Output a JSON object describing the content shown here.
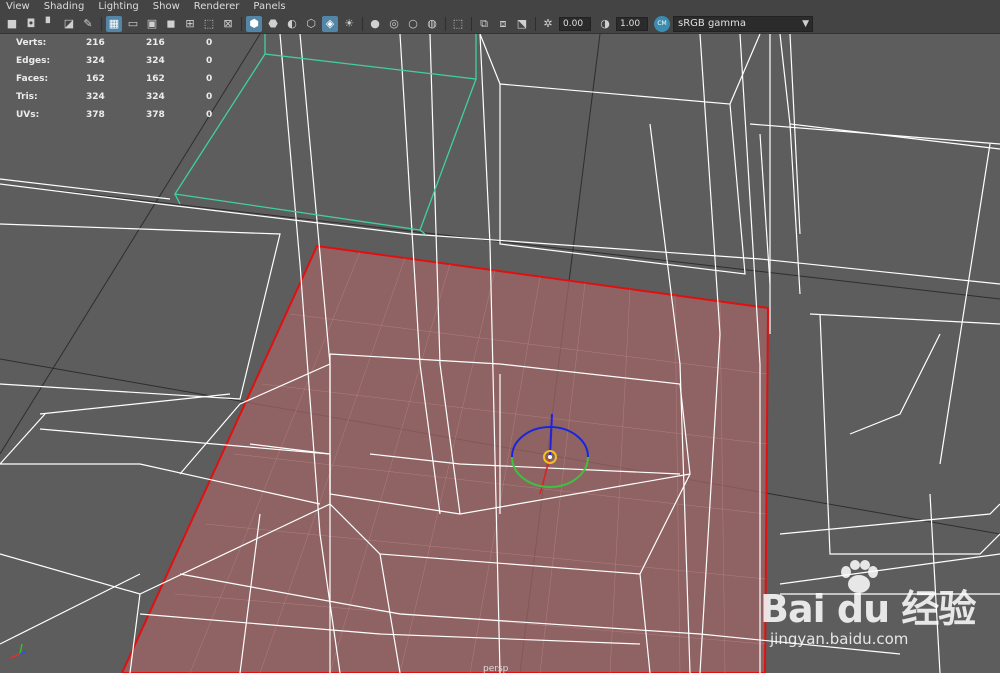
{
  "menubar": {
    "items": [
      "View",
      "Shading",
      "Lighting",
      "Show",
      "Renderer",
      "Panels"
    ]
  },
  "toolbar": {
    "icons": [
      "camera-icon",
      "camera-attributes-icon",
      "bookmark-icon",
      "image-plane-icon",
      "grease-pencil-icon",
      "grid-icon",
      "film-gate-icon",
      "resolution-gate-icon",
      "gate-mask-icon",
      "field-chart-icon",
      "safe-action-icon",
      "safe-title-icon",
      "wireframe-icon",
      "smooth-shade-icon",
      "default-material-icon",
      "textured-icon",
      "use-lights-icon",
      "shadows-icon",
      "screen-space-ao-icon",
      "motion-blur-icon",
      "anti-alias-icon",
      "depth-of-field-icon",
      "isolate-select-icon",
      "xray-icon",
      "xray-joints-icon",
      "backface-culling-icon",
      "exposure-icon",
      "gamma-icon",
      "color-management-icon"
    ],
    "exposure": "0.00",
    "gamma": "1.00",
    "color_space": "sRGB gamma",
    "active_color": "#5285a6"
  },
  "hud": {
    "rows": [
      {
        "label": "Verts:",
        "v1": "216",
        "v2": "216",
        "v3": "0"
      },
      {
        "label": "Edges:",
        "v1": "324",
        "v2": "324",
        "v3": "0"
      },
      {
        "label": "Faces:",
        "v1": "162",
        "v2": "162",
        "v3": "0"
      },
      {
        "label": "Tris:",
        "v1": "324",
        "v2": "324",
        "v3": "0"
      },
      {
        "label": "UVs:",
        "v1": "378",
        "v2": "378",
        "v3": "0"
      }
    ]
  },
  "viewport": {
    "background": "#5d5d5d",
    "wire_color": "#ffffff",
    "selected_face_color": "#a06060",
    "selected_border_color": "#e01010",
    "cube_highlight_color": "#40d0a0",
    "camera_name": "persp"
  },
  "watermark": {
    "logo": "Bai du 经验",
    "url": "jingyan.baidu.com"
  }
}
